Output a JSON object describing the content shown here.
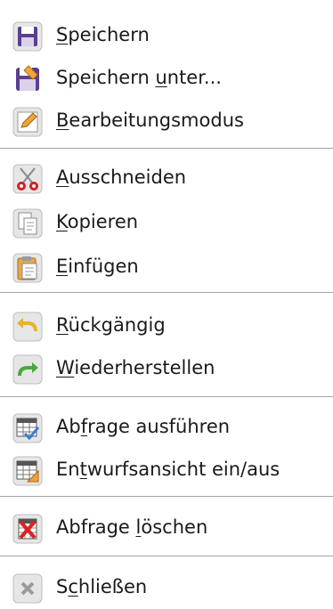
{
  "menu": {
    "items": [
      {
        "pre": "",
        "key": "S",
        "post": "peichern",
        "icon": "save-icon"
      },
      {
        "pre": "Speichern ",
        "key": "u",
        "post": "nter...",
        "icon": "save-as-icon"
      },
      {
        "pre": "",
        "key": "B",
        "post": "earbeitungsmodus",
        "icon": "edit-mode-icon"
      },
      {
        "pre": "",
        "key": "A",
        "post": "usschneiden",
        "icon": "scissors-icon"
      },
      {
        "pre": "",
        "key": "K",
        "post": "opieren",
        "icon": "copy-icon"
      },
      {
        "pre": "",
        "key": "E",
        "post": "infügen",
        "icon": "paste-icon"
      },
      {
        "pre": "",
        "key": "R",
        "post": "ückgängig",
        "icon": "undo-icon"
      },
      {
        "pre": "",
        "key": "W",
        "post": "iederherstellen",
        "icon": "redo-icon"
      },
      {
        "pre": "Ab",
        "key": "f",
        "post": "rage ausführen",
        "icon": "run-query-icon"
      },
      {
        "pre": "En",
        "key": "t",
        "post": "wurfsansicht ein/aus",
        "icon": "design-view-icon"
      },
      {
        "pre": "Abfrage ",
        "key": "l",
        "post": "öschen",
        "icon": "delete-query-icon"
      },
      {
        "pre": "S",
        "key": "c",
        "post": "hließen",
        "icon": "close-icon"
      }
    ]
  },
  "colors": {
    "separator": "#a6a6a6",
    "text": "#1a1a1a",
    "icon_frame": "#c8c8c8",
    "save_purple": "#5b3f8f",
    "scissors_red": "#d21f2b",
    "undo_yellow": "#e8b428",
    "redo_green": "#4aa83c",
    "query_blue": "#3d7bd6",
    "design_orange": "#f0a040",
    "delete_red": "#e02020"
  }
}
